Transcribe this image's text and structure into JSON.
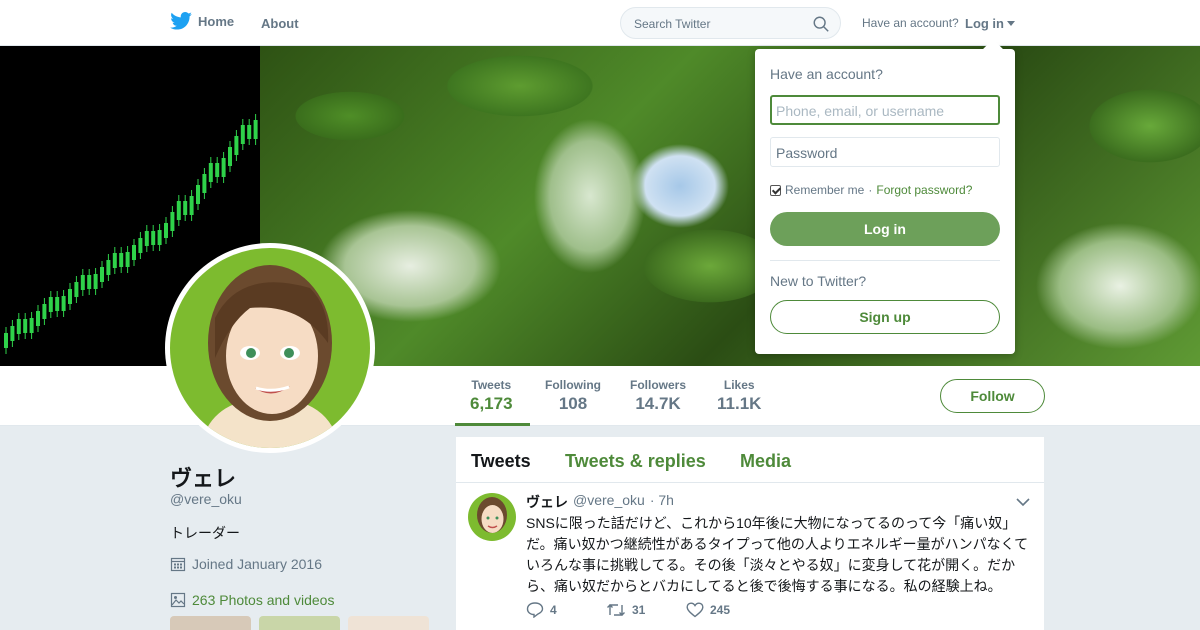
{
  "nav": {
    "home_label": "Home",
    "about_label": "About",
    "search_placeholder": "Search Twitter",
    "have_account": "Have an account?",
    "login_label": "Log in"
  },
  "login_dropdown": {
    "title": "Have an account?",
    "username_placeholder": "Phone, email, or username",
    "password_placeholder": "Password",
    "remember_me": "Remember me",
    "separator": "·",
    "forgot_password": "Forgot password?",
    "login_button": "Log in",
    "new_to_twitter": "New to Twitter?",
    "signup_button": "Sign up"
  },
  "stats": [
    {
      "label": "Tweets",
      "value": "6,173"
    },
    {
      "label": "Following",
      "value": "108"
    },
    {
      "label": "Followers",
      "value": "14.7K"
    },
    {
      "label": "Likes",
      "value": "11.1K"
    }
  ],
  "follow_button": "Follow",
  "profile": {
    "name": "ヴェレ",
    "handle": "@vere_oku",
    "bio": "トレーダー",
    "joined": "Joined January 2016",
    "photos": "263 Photos and videos"
  },
  "timeline_tabs": [
    "Tweets",
    "Tweets & replies",
    "Media"
  ],
  "tweet": {
    "author": "ヴェレ",
    "handle": "@vere_oku",
    "time": "· 7h",
    "text": "SNSに限った話だけど、これから10年後に大物になってるのって今「痛い奴」だ。痛い奴かつ継続性があるタイプって他の人よりエネルギー量がハンパなくていろんな事に挑戦してる。その後「淡々とやる奴」に変身して花が開く。だから、痛い奴だからとバカにしてると後で後悔する事になる。私の経験上ね。",
    "replies": "4",
    "retweets": "31",
    "likes": "245"
  },
  "colors": {
    "accent": "#4e8a3a",
    "button_fill": "#6da05a",
    "twitter_blue": "#1da1f2"
  },
  "icons": [
    "twitter-bird-icon",
    "search-icon",
    "caret-down-icon",
    "calendar-icon",
    "photo-icon",
    "reply-icon",
    "retweet-icon",
    "heart-icon",
    "chevron-down-icon"
  ]
}
